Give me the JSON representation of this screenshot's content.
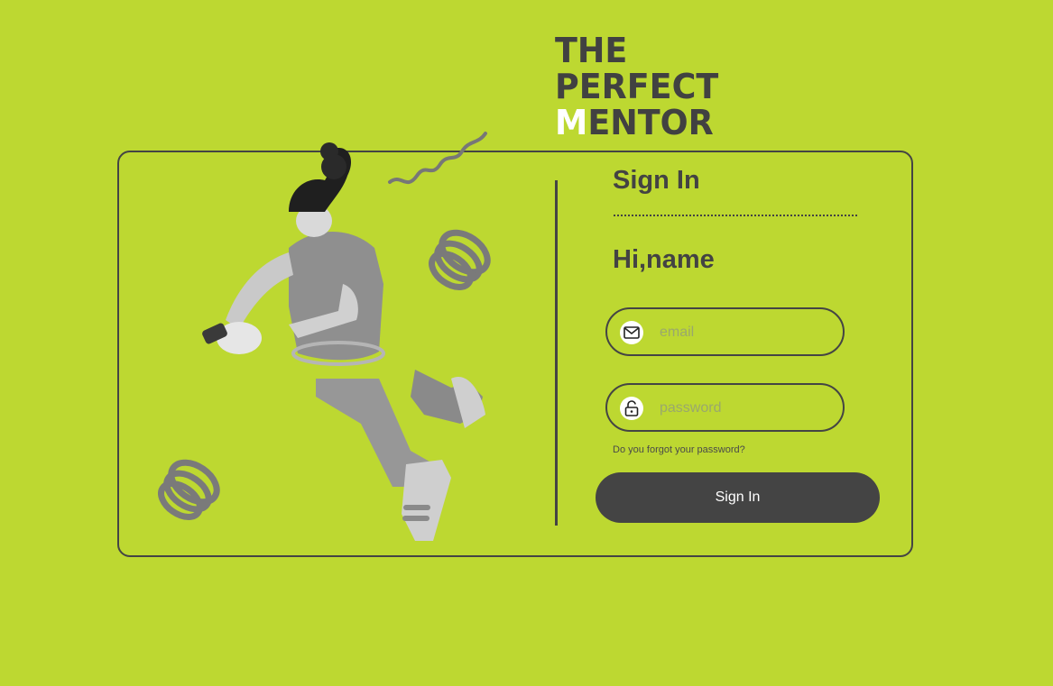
{
  "logo": {
    "line1": "THE",
    "line2": "PERFECT",
    "line3_accent": "M",
    "line3_rest": "ENTOR"
  },
  "signin": {
    "title": "Sign In",
    "greeting": "Hi,name",
    "email_placeholder": "email",
    "password_placeholder": "password",
    "forgot_text": "Do you forgot your password?",
    "button_label": "Sign In"
  },
  "icons": {
    "email": "envelope-icon",
    "password": "unlock-icon"
  },
  "colors": {
    "background": "#bdd831",
    "dark": "#434343",
    "accent_white": "#ffffff"
  }
}
